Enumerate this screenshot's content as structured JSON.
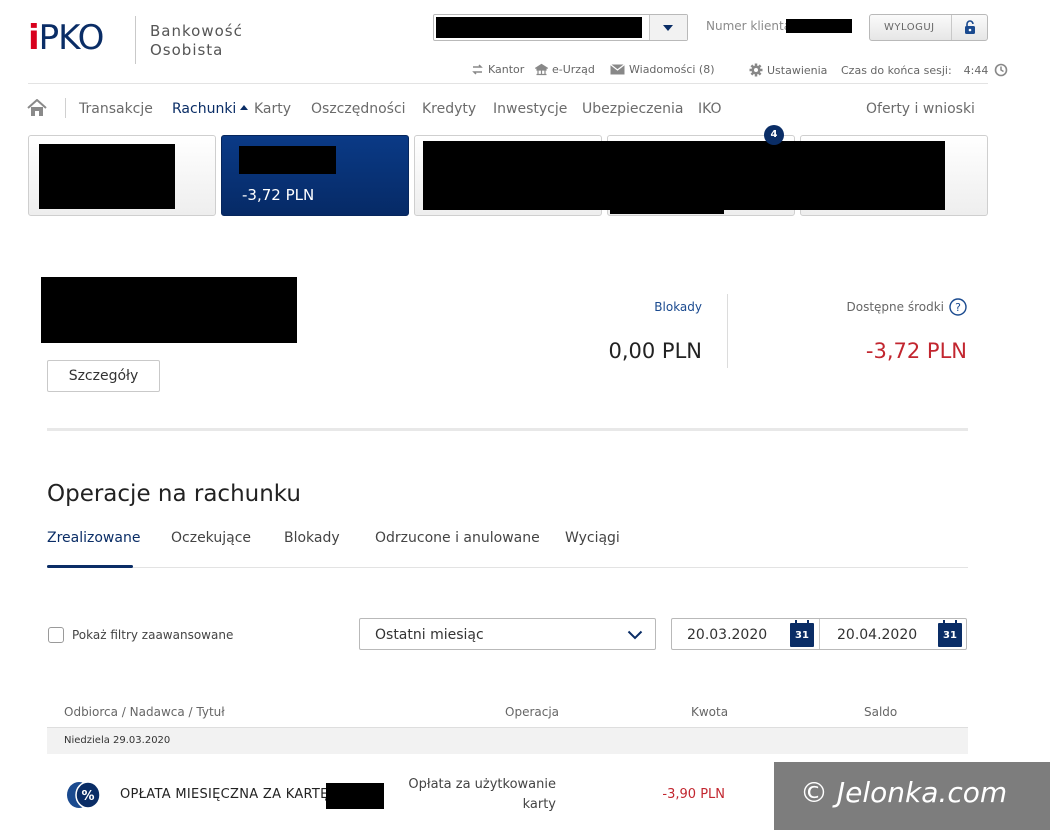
{
  "header": {
    "logo_text": "PKO",
    "logo_i": "i",
    "brand_line1": "Bankowość",
    "brand_line2": "Osobista",
    "client_label": "Numer klienta",
    "logout_label": "WYLOGUJ"
  },
  "utility": {
    "kantor": "Kantor",
    "eurzad": "e-Urząd",
    "messages": "Wiadomości (8)",
    "settings": "Ustawienia",
    "session_label": "Czas do końca sesji:",
    "session_time": "4:44"
  },
  "nav": {
    "items": [
      "Transakcje",
      "Rachunki",
      "Karty",
      "Oszczędności",
      "Kredyty",
      "Inwestycje",
      "Ubezpieczenia",
      "IKO"
    ],
    "right": "Oferty i wnioski",
    "active": "Rachunki"
  },
  "tiles": {
    "active_balance": "-3,72 PLN",
    "badge_count": "4"
  },
  "summary": {
    "details_button": "Szczegóły",
    "blocks_label": "Blokady",
    "blocks_value": "0,00 PLN",
    "available_label": "Dostępne środki",
    "available_value": "-3,72 PLN"
  },
  "operations": {
    "title": "Operacje na rachunku",
    "tabs": [
      "Zrealizowane",
      "Oczekujące",
      "Blokady",
      "Odrzucone i anulowane",
      "Wyciągi"
    ],
    "active_tab": "Zrealizowane",
    "filter_checkbox_label": "Pokaż filtry zaawansowane",
    "period_value": "Ostatni miesiąc",
    "date_from": "20.03.2020",
    "date_to": "20.04.2020",
    "calendar_day": "31",
    "columns": [
      "Odbiorca / Nadawca / Tytuł",
      "Operacja",
      "Kwota",
      "Saldo"
    ],
    "day_header": "Niedziela 29.03.2020",
    "rows": [
      {
        "name": "OPŁATA MIESIĘCZNA ZA KARTĘ",
        "operation_line1": "Opłata za użytkowanie",
        "operation_line2": "karty",
        "amount": "-3,90 PLN"
      }
    ]
  },
  "watermark": "© Jelonka.com",
  "colors": {
    "brand_navy": "#0a2d66",
    "brand_red": "#d8001d",
    "negative": "#c2262f"
  }
}
